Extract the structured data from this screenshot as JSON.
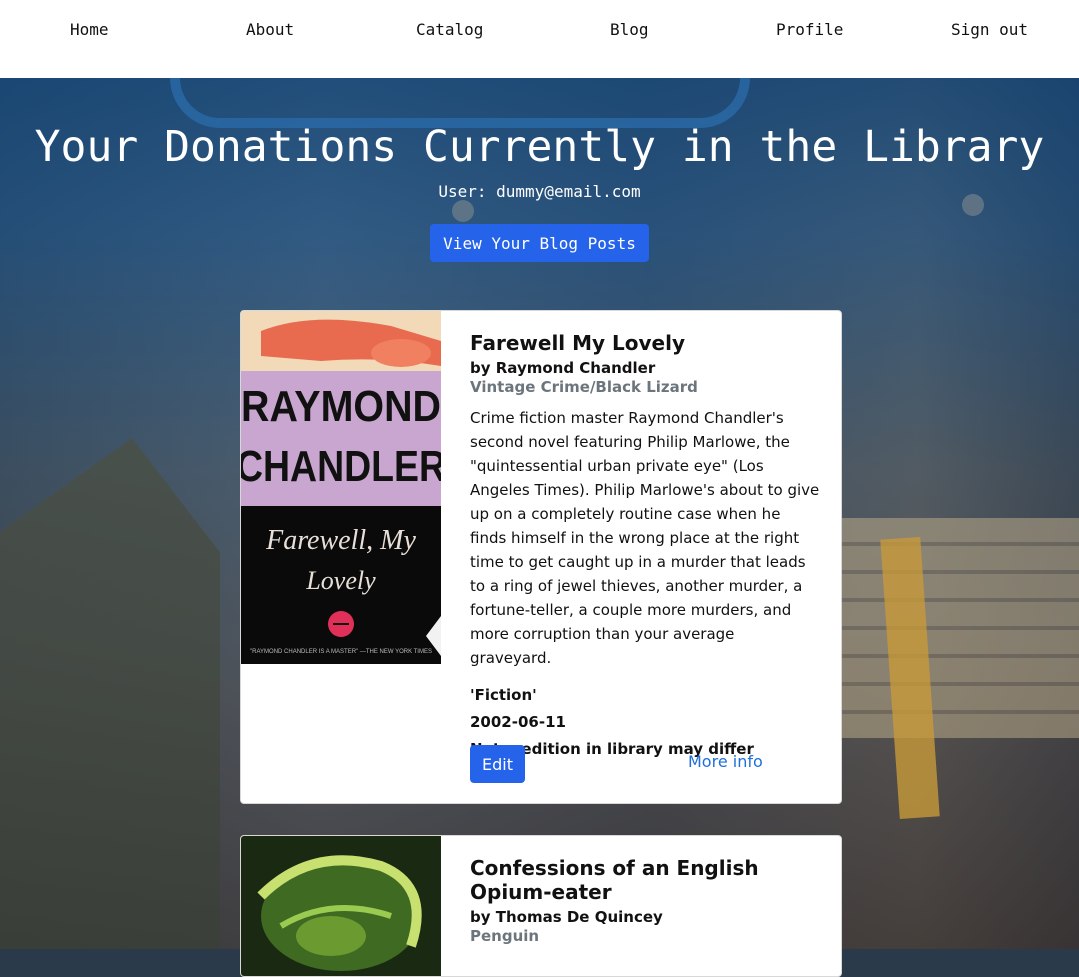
{
  "nav": {
    "items": [
      "Home",
      "About",
      "Catalog",
      "Blog",
      "Profile",
      "Sign out"
    ]
  },
  "hero": {
    "title": "Your Donations Currently in the Library",
    "user": "User: dummy@email.com",
    "blog_button": "View Your Blog Posts"
  },
  "books": [
    {
      "title": "Farewell My Lovely",
      "author": "by Raymond Chandler",
      "publisher": "Vintage Crime/Black Lizard",
      "description": "Crime fiction master Raymond Chandler's second novel featuring Philip Marlowe, the \"quintessential urban private eye\" (Los Angeles Times). Philip Marlowe's about to give up on a completely routine case when he finds himself in the wrong place at the right time to get caught up in a murder that leads to a ring of jewel thieves, another murder, a fortune-teller, a couple more murders, and more corruption than your average graveyard.",
      "genre": "'Fiction'",
      "date": "2002-06-11",
      "note": "Note: edition in library may differ",
      "edit_label": "Edit",
      "more_label": "More info",
      "cover": {
        "line1": "RAYMOND",
        "line2": "CHANDLER",
        "line3": "Farewell, My",
        "line4": "Lovely",
        "blurb": "\"RAYMOND CHANDLER IS A MASTER\" —THE NEW YORK TIMES"
      }
    },
    {
      "title": "Confessions of an English Opium-eater",
      "author": "by Thomas De Quincey",
      "publisher": "Penguin"
    }
  ]
}
